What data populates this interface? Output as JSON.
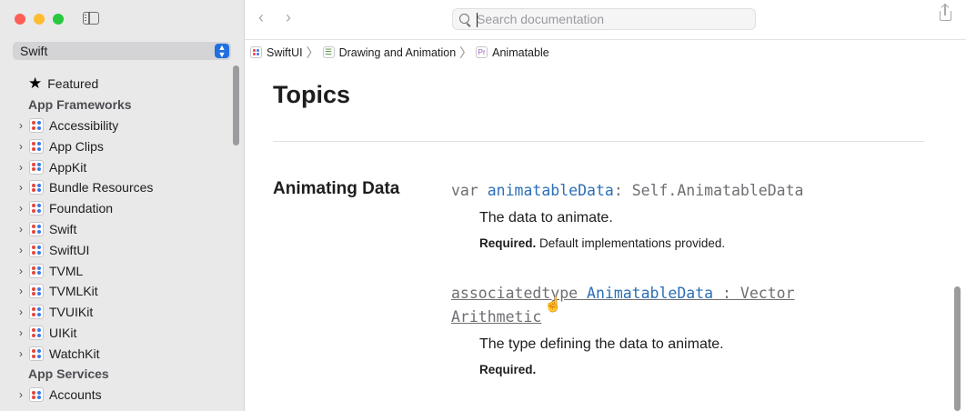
{
  "sidebar": {
    "language_selector": "Swift",
    "featured_label": "Featured",
    "sections": [
      {
        "title": "App Frameworks"
      },
      {
        "title": "App Services"
      }
    ],
    "app_frameworks": [
      "Accessibility",
      "App Clips",
      "AppKit",
      "Bundle Resources",
      "Foundation",
      "Swift",
      "SwiftUI",
      "TVML",
      "TVMLKit",
      "TVUIKit",
      "UIKit",
      "WatchKit"
    ],
    "app_services": [
      "Accounts"
    ]
  },
  "toolbar": {
    "search_placeholder": "Search documentation"
  },
  "breadcrumb": [
    "SwiftUI",
    "Drawing and Animation",
    "Animatable"
  ],
  "breadcrumb_icons": [
    "framework-icon",
    "document-list-icon",
    "protocol-icon"
  ],
  "breadcrumb_protocol_glyph": "Pr",
  "content": {
    "section_title": "Topics",
    "group_title": "Animating Data",
    "items": [
      {
        "kw": "var ",
        "name": "animatableData",
        "rest": ": Self.AnimatableData",
        "description": "The data to animate.",
        "req_label": "Required.",
        "req_text": " Default implementations provided."
      },
      {
        "kw": "associatedtype ",
        "name": "AnimatableData",
        "rest": " : Vector",
        "rest2": "Arithmetic",
        "description": "The type defining the data to animate.",
        "req_label": "Required.",
        "req_text": ""
      }
    ]
  },
  "colors": {
    "accent": "#1f6fe0",
    "identifier": "#2c6fb5",
    "sidebar_bg": "#e9e9ea"
  }
}
